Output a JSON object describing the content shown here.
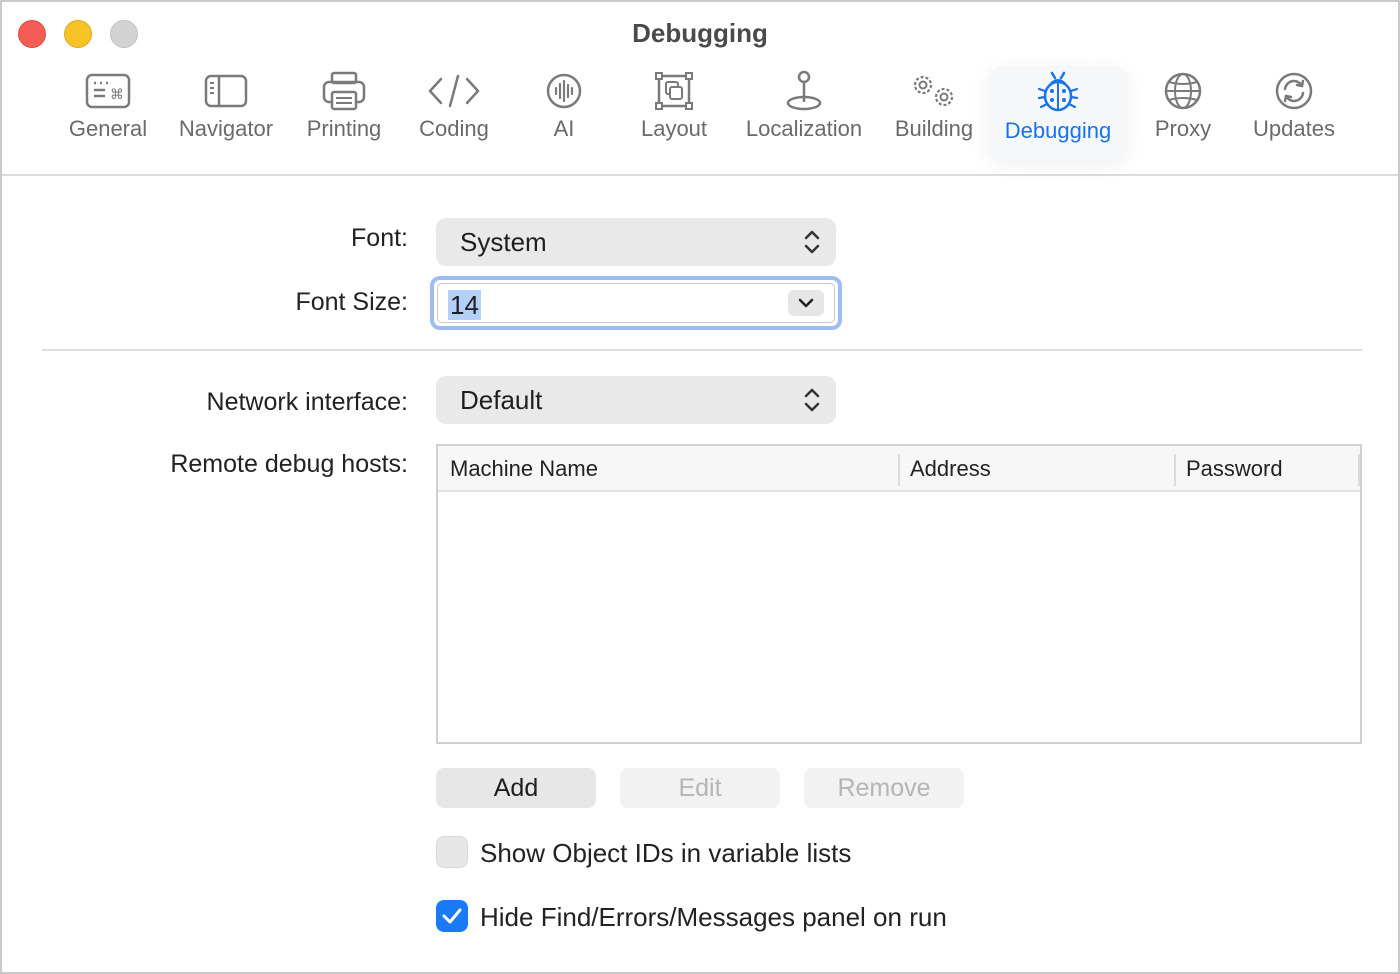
{
  "window": {
    "title": "Debugging"
  },
  "toolbar": {
    "tabs": [
      {
        "label": "General",
        "icon": "keyboard-icon"
      },
      {
        "label": "Navigator",
        "icon": "sidebar-icon"
      },
      {
        "label": "Printing",
        "icon": "printer-icon"
      },
      {
        "label": "Coding",
        "icon": "code-brackets-icon"
      },
      {
        "label": "AI",
        "icon": "waveform-circle-icon"
      },
      {
        "label": "Layout",
        "icon": "layout-frame-icon"
      },
      {
        "label": "Localization",
        "icon": "pin-icon"
      },
      {
        "label": "Building",
        "icon": "gears-icon"
      },
      {
        "label": "Debugging",
        "icon": "ladybug-icon",
        "active": true
      },
      {
        "label": "Proxy",
        "icon": "globe-icon"
      },
      {
        "label": "Updates",
        "icon": "refresh-icon"
      }
    ]
  },
  "form": {
    "font_label": "Font:",
    "font_value": "System",
    "font_size_label": "Font Size:",
    "font_size_value": "14",
    "network_label": "Network interface:",
    "network_value": "Default",
    "remote_label": "Remote debug hosts:"
  },
  "hosts_table": {
    "columns": [
      "Machine Name",
      "Address",
      "Password"
    ],
    "rows": []
  },
  "buttons": {
    "add": "Add",
    "edit": "Edit",
    "remove": "Remove"
  },
  "options": {
    "show_ids_label": "Show Object IDs in variable lists",
    "show_ids_checked": false,
    "hide_panel_label": "Hide Find/Errors/Messages panel on run",
    "hide_panel_checked": true
  },
  "colors": {
    "accent": "#1a73e8",
    "close": "#f45c55",
    "minimize": "#f8c327",
    "zoom": "#d3d3d3"
  }
}
